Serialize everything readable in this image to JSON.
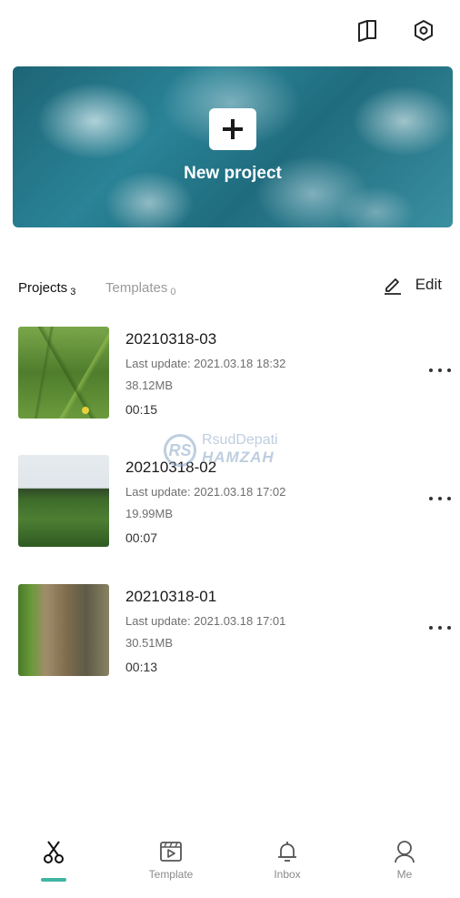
{
  "top_bar": {
    "icons": [
      "book-icon",
      "gear-icon"
    ]
  },
  "banner": {
    "label": "New project"
  },
  "tabs": {
    "projects_label": "Projects",
    "projects_count": "3",
    "templates_label": "Templates",
    "templates_count": "0",
    "edit_label": "Edit"
  },
  "projects": [
    {
      "title": "20210318-03",
      "last_update": "Last update: 2021.03.18 18:32",
      "size": "38.12MB",
      "duration": "00:15"
    },
    {
      "title": "20210318-02",
      "last_update": "Last update: 2021.03.18 17:02",
      "size": "19.99MB",
      "duration": "00:07"
    },
    {
      "title": "20210318-01",
      "last_update": "Last update: 2021.03.18 17:01",
      "size": "30.51MB",
      "duration": "00:13"
    }
  ],
  "watermark": {
    "logo_text": "RS",
    "line1": "RsudDepati",
    "line2": "HAMZAH"
  },
  "bottom_nav": {
    "items": [
      {
        "label": "",
        "icon": "scissors-icon",
        "active": true
      },
      {
        "label": "Template",
        "icon": "template-icon"
      },
      {
        "label": "Inbox",
        "icon": "bell-icon"
      },
      {
        "label": "Me",
        "icon": "person-icon"
      }
    ],
    "active_color": "#3fb5a2"
  }
}
